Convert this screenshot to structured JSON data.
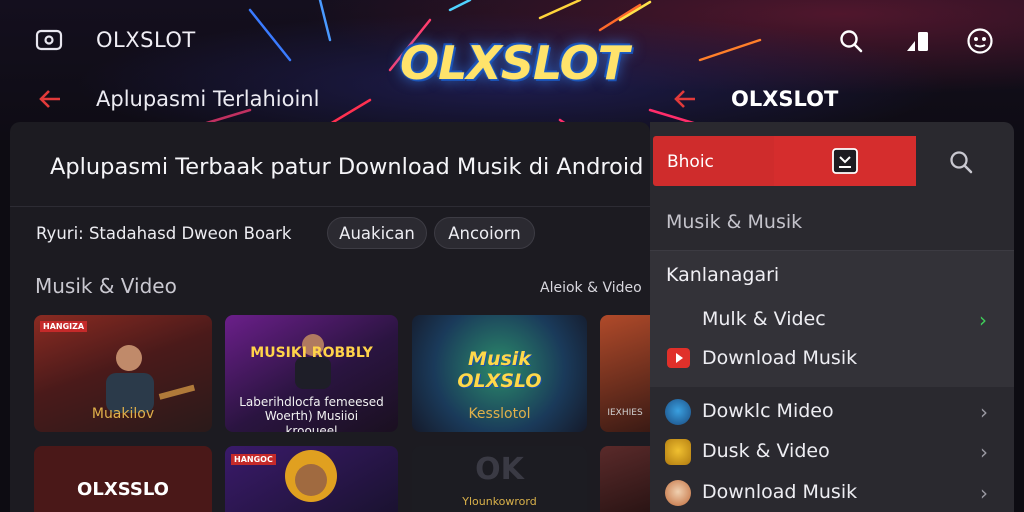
{
  "header": {
    "brand": "OLXSLOT",
    "logo": "OLXSLOT",
    "back_title": "Aplupasmi Terlahioinl",
    "icons": [
      "cast-icon",
      "search-icon",
      "signal-icon",
      "profile-icon"
    ]
  },
  "main": {
    "heading": "Aplupasmi Terbaak patur Download Musik di Android",
    "chips": [
      "Ryuri: Stadahasd Dweon Boark",
      "Auakican",
      "Ancoiorn"
    ],
    "section_title": "Musik & Video",
    "section_link": "Aleiok & Video",
    "tiles": [
      {
        "badge": "HANGIZA",
        "caption": "Muakilov"
      },
      {
        "banner": "MUSIKI ROBBLY",
        "sub": "Laberihdlocfa femeesed Woerth) Musiioi krooueel",
        "caption": ""
      },
      {
        "banner": "Musik OLXSLO",
        "caption": "Kesslotol"
      },
      {
        "caption": "IEXHIES"
      },
      {
        "banner": "OLXSSLO",
        "caption": ""
      },
      {
        "badge": "HANGOC",
        "caption": ""
      },
      {
        "banner": "OK",
        "caption": "Ylounkowrord"
      },
      {
        "caption": ""
      }
    ]
  },
  "right_panel": {
    "title": "OLXSLOT",
    "search_text": "Bhoic",
    "section_header": "Musik & Musik",
    "group_title": "Kanlanagari",
    "group_items": [
      "Mulk & Videc",
      "Download Musik"
    ],
    "list_items": [
      "Dowklc Mideo",
      "Dusk & Video",
      "Download Musik"
    ]
  },
  "colors": {
    "accent_red": "#cf2c2c",
    "panel_dark": "#1c1b21",
    "panel_right": "#2a292f",
    "chevron_green": "#3fcf5a"
  }
}
